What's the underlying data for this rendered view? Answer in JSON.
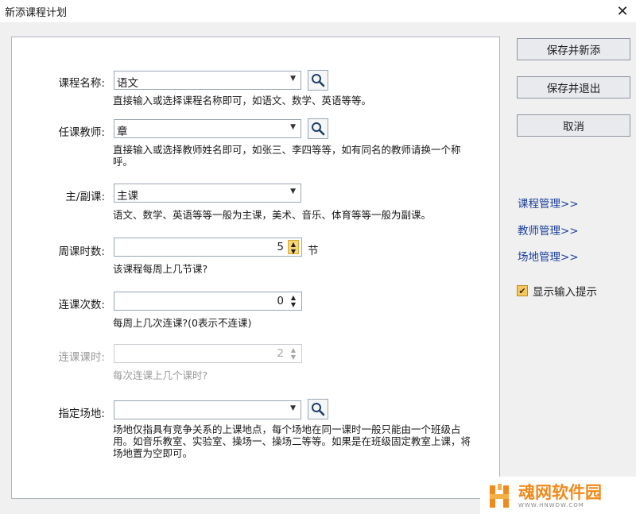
{
  "window": {
    "title": "新添课程计划",
    "close_glyph": "✕"
  },
  "form": {
    "course_name": {
      "label": "课程名称:",
      "value": "语文",
      "hint": "直接输入或选择课程名称即可，如语文、数学、英语等等。"
    },
    "teacher": {
      "label": "任课教师:",
      "value": "章",
      "hint": "直接输入或选择教师姓名即可，如张三、李四等等，如有同名的教师请换一个称呼。"
    },
    "main_sub": {
      "label": "主/副课:",
      "value": "主课",
      "hint": "语文、数学、英语等等一般为主课，美术、音乐、体育等等一般为副课。"
    },
    "weekly_hours": {
      "label": "周课时数:",
      "value": "5",
      "unit": "节",
      "hint": "该课程每周上几节课?"
    },
    "consecutive_count": {
      "label": "连课次数:",
      "value": "0",
      "hint": "每周上几次连课?(0表示不连课)"
    },
    "consecutive_hours": {
      "label": "连课课时:",
      "value": "2",
      "hint": "每次连课上几个课时?",
      "disabled": true
    },
    "venue": {
      "label": "指定场地:",
      "value": "",
      "hint": "场地仅指具有竞争关系的上课地点，每个场地在同一课时一般只能由一个班级占用。如音乐教室、实验室、操场一、操场二等等。如果是在班级固定教室上课，将场地置为空即可。"
    }
  },
  "actions": {
    "save_and_new": "保存并新添",
    "save_and_exit": "保存并退出",
    "cancel": "取消"
  },
  "links": {
    "course_manage": "课程管理>>",
    "teacher_manage": "教师管理>>",
    "venue_manage": "场地管理>>"
  },
  "options": {
    "show_input_hint_label": "显示输入提示",
    "show_input_hint_checked": true
  },
  "watermark": {
    "name": "魂网软件园",
    "url": "WWW.HNWDW.COM"
  },
  "icons": {
    "search": "search-icon",
    "dropdown": "chevron-down-icon",
    "spin": "spin-updown-icon",
    "check": "checkmark-icon"
  },
  "colors": {
    "link": "#1c3f9e",
    "checkbox_fill": "#f6c75a",
    "spin_active": "#f7d67a",
    "watermark_orange": "#f08a1c"
  }
}
